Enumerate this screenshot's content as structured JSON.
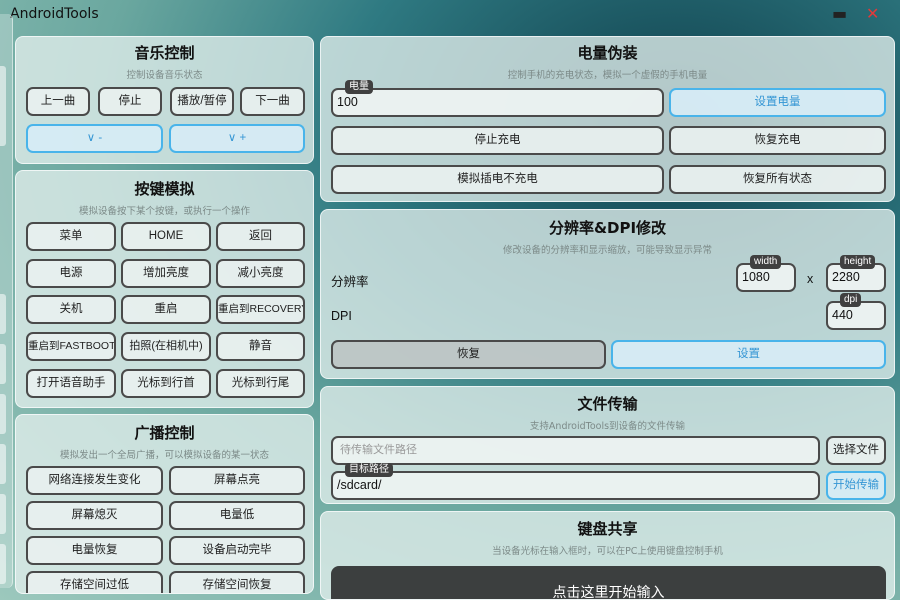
{
  "app": {
    "title": "AndroidTools",
    "minimize_icon": "minimize-icon",
    "close_icon": "close-icon",
    "minimize_glyph": "▬",
    "close_glyph": "✕"
  },
  "music": {
    "title": "音乐控制",
    "subtitle": "控制设备音乐状态",
    "buttons": [
      "上一曲",
      "停止",
      "播放/暂停",
      "下一曲"
    ],
    "vol_down": "∨ -",
    "vol_up": "∨ +"
  },
  "keys": {
    "title": "按键模拟",
    "subtitle": "模拟设备按下某个按键，或执行一个操作",
    "buttons": [
      "菜单",
      "HOME",
      "返回",
      "电源",
      "增加亮度",
      "减小亮度",
      "关机",
      "重启",
      "重启到RECOVERY",
      "重启到FASTBOOT",
      "拍照(在相机中)",
      "静音",
      "打开语音助手",
      "光标到行首",
      "光标到行尾"
    ]
  },
  "broadcast": {
    "title": "广播控制",
    "subtitle": "模拟发出一个全局广播，可以模拟设备的某一状态",
    "buttons": [
      "网络连接发生变化",
      "屏幕点亮",
      "屏幕熄灭",
      "电量低",
      "电量恢复",
      "设备启动完毕",
      "存储空间过低",
      "存储空间恢复"
    ]
  },
  "battery": {
    "title": "电量伪装",
    "subtitle": "控制手机的充电状态，模拟一个虚假的手机电量",
    "field_tag": "电量",
    "field_value": "100",
    "set_button": "设置电量",
    "stop_charge": "停止充电",
    "resume_charge": "恢复充电",
    "unplug_sim": "模拟插电不充电",
    "reset_all": "恢复所有状态"
  },
  "resolution": {
    "title": "分辨率&DPI修改",
    "subtitle": "修改设备的分辨率和显示缩放，可能导致显示异常",
    "res_label": "分辨率",
    "width_tag": "width",
    "width_value": "1080",
    "times": "x",
    "height_tag": "height",
    "height_value": "2280",
    "dpi_label": "DPI",
    "dpi_tag": "dpi",
    "dpi_value": "440",
    "restore_button": "恢复",
    "apply_button": "设置"
  },
  "transfer": {
    "title": "文件传输",
    "subtitle": "支持AndroidTools到设备的文件传输",
    "file_placeholder": "待传输文件路径",
    "choose_button": "选择文件",
    "target_tag": "目标路径",
    "target_value": "/sdcard/",
    "start_button": "开始传输"
  },
  "keyboard": {
    "title": "键盘共享",
    "subtitle": "当设备光标在输入框时，可以在PC上使用键盘控制手机",
    "start_button": "点击这里开始输入"
  }
}
